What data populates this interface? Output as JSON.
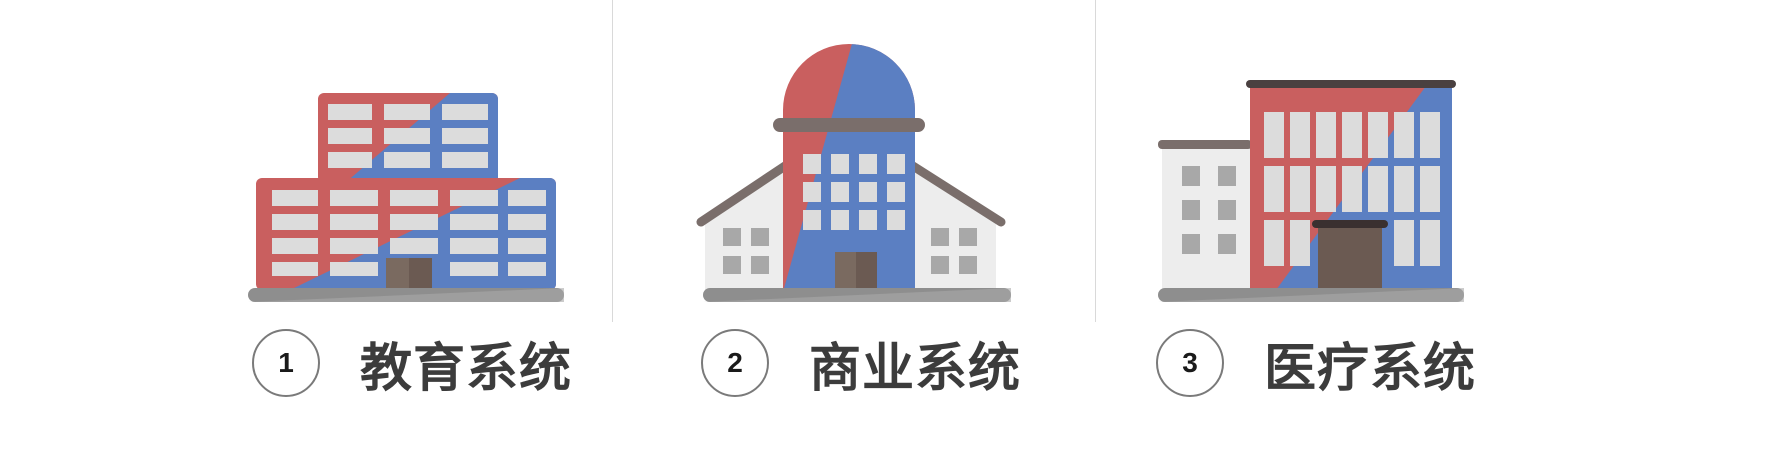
{
  "colors": {
    "red": "#c95f5f",
    "blue": "#5b7fc2",
    "window": "#dcdcdc",
    "ground": "#8e8e8e",
    "roof": "#7a6e6b",
    "door": "#6b5a52",
    "white_wall": "#ededed",
    "divider": "#d9d9d9",
    "text": "#3c3c3c"
  },
  "items": [
    {
      "number": "1",
      "label": "教育系统",
      "icon": "school-building-icon"
    },
    {
      "number": "2",
      "label": "商业系统",
      "icon": "dome-building-icon"
    },
    {
      "number": "3",
      "label": "医疗系统",
      "icon": "hospital-building-icon"
    }
  ]
}
